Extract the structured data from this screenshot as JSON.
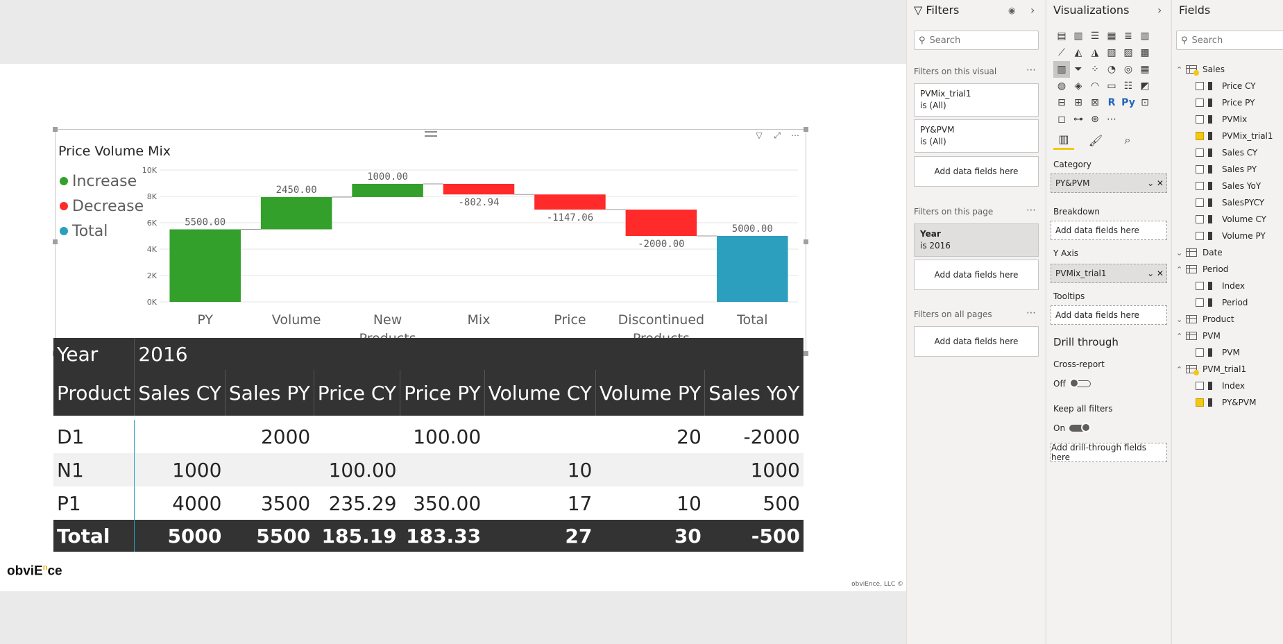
{
  "visual": {
    "title": "Price Volume Mix",
    "legend": [
      {
        "label": "Increase",
        "color": "#33a02c"
      },
      {
        "label": "Decrease",
        "color": "#ff2a2a"
      },
      {
        "label": "Total",
        "color": "#2b9fbd"
      }
    ]
  },
  "chart_data": {
    "type": "bar",
    "subtype": "waterfall",
    "title": "Price Volume Mix",
    "categories": [
      "PY",
      "Volume",
      "New\nProducts",
      "Mix",
      "Price",
      "Discontinued\nProducts",
      "Total"
    ],
    "values": [
      5500,
      2450,
      1000,
      -802.94,
      -1147.06,
      -2000,
      5000
    ],
    "data_labels": [
      "5500.00",
      "2450.00",
      "1000.00",
      "-802.94",
      "-1147.06",
      "-2000.00",
      "5000.00"
    ],
    "kinds": [
      "increase",
      "increase",
      "increase",
      "decrease",
      "decrease",
      "decrease",
      "total"
    ],
    "y_ticks": [
      "0K",
      "2K",
      "4K",
      "6K",
      "8K",
      "10K"
    ],
    "ylim": [
      0,
      10000
    ],
    "grid": true,
    "legend_position": "left"
  },
  "matrix": {
    "year_label": "Year",
    "year_value": "2016",
    "headers": [
      "Product",
      "Sales CY",
      "Sales PY",
      "Price CY",
      "Price PY",
      "Volume CY",
      "Volume PY",
      "Sales YoY"
    ],
    "rows": [
      [
        "D1",
        "",
        "2000",
        "",
        "100.00",
        "",
        "20",
        "-2000"
      ],
      [
        "N1",
        "1000",
        "",
        "100.00",
        "",
        "10",
        "",
        "1000"
      ],
      [
        "P1",
        "4000",
        "3500",
        "235.29",
        "350.00",
        "17",
        "10",
        "500"
      ]
    ],
    "total": [
      "Total",
      "5000",
      "5500",
      "185.19",
      "183.33",
      "27",
      "30",
      "-500"
    ]
  },
  "brand": {
    "text_a": "obviE",
    "text_sup": "n",
    "text_b": "ce"
  },
  "copyright": "obviEnce, LLC ©",
  "filters": {
    "title": "Filters",
    "search_placeholder": "Search",
    "on_visual_label": "Filters on this visual",
    "visual_filters": [
      {
        "name": "PVMix_trial1",
        "state": "is (All)"
      },
      {
        "name": "PY&PVM",
        "state": "is (All)"
      }
    ],
    "add_fields": "Add data fields here",
    "on_page_label": "Filters on this page",
    "page_filter": {
      "name": "Year",
      "state": "is 2016"
    },
    "on_all_label": "Filters on all pages"
  },
  "visualizations": {
    "title": "Visualizations",
    "category_label": "Category",
    "category_value": "PY&PVM",
    "breakdown_label": "Breakdown",
    "yaxis_label": "Y Axis",
    "yaxis_value": "PVMix_trial1",
    "tooltips_label": "Tooltips",
    "add_fields": "Add data fields here",
    "drill_title": "Drill through",
    "cross_report_label": "Cross-report",
    "cross_report_state": "Off",
    "keep_filters_label": "Keep all filters",
    "keep_filters_state": "On",
    "add_drill": "Add drill-through fields here"
  },
  "fields": {
    "title": "Fields",
    "search_placeholder": "Search",
    "tables": [
      {
        "name": "Sales",
        "expanded": true,
        "items": [
          {
            "name": "Price CY",
            "checked": false
          },
          {
            "name": "Price PY",
            "checked": false
          },
          {
            "name": "PVMix",
            "checked": false
          },
          {
            "name": "PVMix_trial1",
            "checked": true
          },
          {
            "name": "Sales CY",
            "checked": false
          },
          {
            "name": "Sales PY",
            "checked": false
          },
          {
            "name": "Sales YoY",
            "checked": false
          },
          {
            "name": "SalesPYCY",
            "checked": false
          },
          {
            "name": "Volume CY",
            "checked": false
          },
          {
            "name": "Volume PY",
            "checked": false
          }
        ]
      },
      {
        "name": "Date",
        "expanded": false,
        "items": []
      },
      {
        "name": "Period",
        "expanded": true,
        "items": [
          {
            "name": "Index",
            "checked": false
          },
          {
            "name": "Period",
            "checked": false
          }
        ]
      },
      {
        "name": "Product",
        "expanded": false,
        "items": []
      },
      {
        "name": "PVM",
        "expanded": true,
        "items": [
          {
            "name": "PVM",
            "checked": false
          }
        ]
      },
      {
        "name": "PVM_trial1",
        "expanded": true,
        "items": [
          {
            "name": "Index",
            "checked": false
          },
          {
            "name": "PY&PVM",
            "checked": true
          }
        ]
      }
    ]
  }
}
